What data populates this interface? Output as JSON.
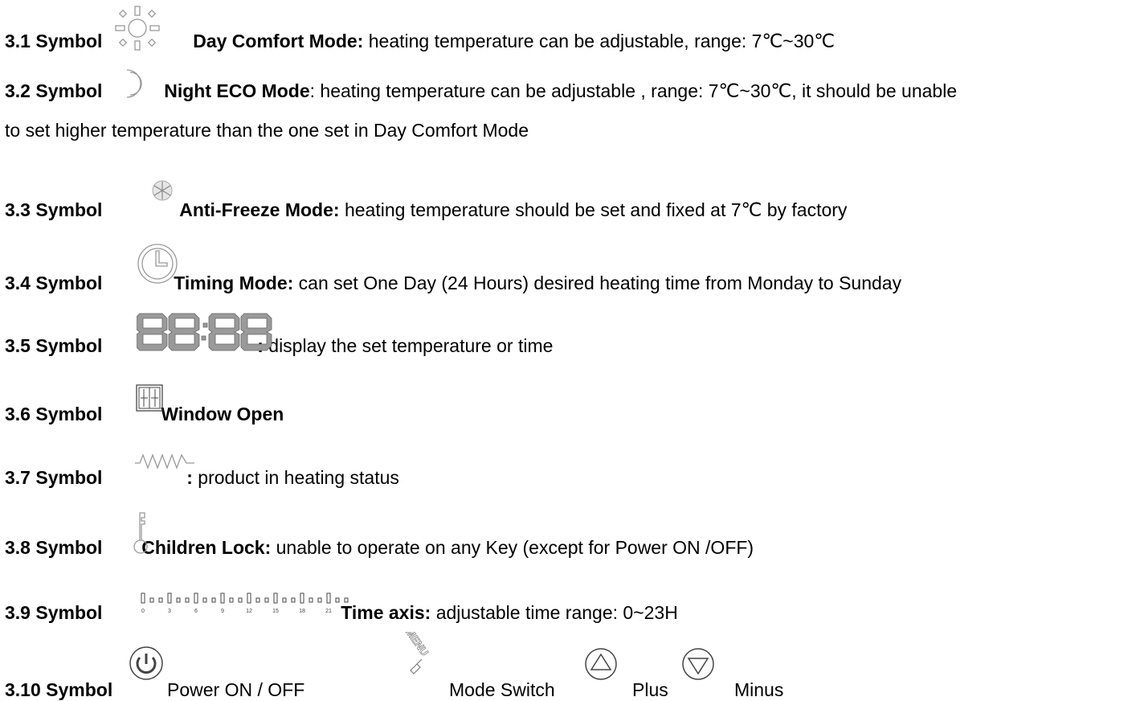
{
  "items": [
    {
      "num": "3.1 Symbol",
      "title": "Day Comfort Mode:",
      "text": " heating temperature can be adjustable, range: 7℃~30℃",
      "icon": "sun-icon"
    },
    {
      "num": "3.2 Symbol",
      "title": "Night ECO Mode",
      "text": ": heating temperature can be adjustable , range: 7℃~30℃, it should be unable",
      "text2": "to set higher temperature than the one set in Day Comfort Mode",
      "icon": "moon-icon"
    },
    {
      "num": "3.3 Symbol",
      "title": "Anti-Freeze Mode:",
      "text": " heating temperature should be set and fixed at 7℃   by factory",
      "icon": "snowflake-icon"
    },
    {
      "num": "3.4 Symbol",
      "title": "Timing Mode:",
      "text": " can set One Day (24 Hours) desired heating time from Monday to Sunday",
      "icon": "clock-icon"
    },
    {
      "num": "3.5 Symbol",
      "title": ":",
      "text": " display the set temperature or time",
      "icon": "seven-segment-display-icon",
      "display": "88:88"
    },
    {
      "num": "3.6 Symbol",
      "title": "Window Open",
      "text": "",
      "icon": "window-icon"
    },
    {
      "num": "3.7 Symbol",
      "title": ":",
      "text": " product in heating status",
      "icon": "heating-wave-icon"
    },
    {
      "num": "3.8 Symbol",
      "title": "Children Lock:",
      "text": " unable to operate on any Key (except for Power ON /OFF)",
      "icon": "key-icon"
    },
    {
      "num": "3.9 Symbol",
      "title": "Time axis:",
      "text": " adjustable time range: 0~23H",
      "icon": "time-axis-icon",
      "axis_labels": [
        "0",
        "3",
        "6",
        "9",
        "12",
        "15",
        "18",
        "21"
      ]
    },
    {
      "num": "3.10  Symbol",
      "icon": "power-icon",
      "buttons": [
        {
          "label": "Power ON / OFF",
          "icon": "power-icon"
        },
        {
          "label": "Mode Switch",
          "icon": "menu-icon",
          "icon_text": "MENU"
        },
        {
          "label": "Plus",
          "icon": "up-arrow-icon"
        },
        {
          "label": "Minus",
          "icon": "down-arrow-icon"
        }
      ]
    }
  ]
}
